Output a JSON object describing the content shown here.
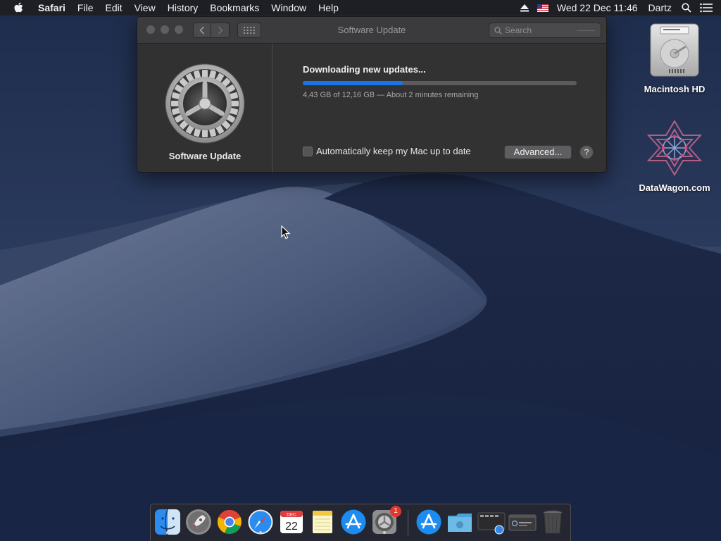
{
  "menubar": {
    "app_name": "Safari",
    "items": [
      "File",
      "Edit",
      "View",
      "History",
      "Bookmarks",
      "Window",
      "Help"
    ],
    "clock": "Wed 22 Dec  11:46",
    "user": "Dartz",
    "status_icons": [
      "eject-icon",
      "us-flag-icon",
      "spotlight-search-icon",
      "notification-center-icon"
    ]
  },
  "window": {
    "title": "Software Update",
    "search_placeholder": "Search",
    "pane_label": "Software Update",
    "status_title": "Downloading new updates...",
    "progress_fraction": 0.3643,
    "progress_detail": "4,43 GB of 12,16 GB — About 2 minutes remaining",
    "auto_update_label": "Automatically keep my Mac up to date",
    "auto_update_checked": false,
    "advanced_label": "Advanced...",
    "help_label": "?"
  },
  "desktop_icons": [
    {
      "label": "Macintosh HD",
      "icon": "hard-drive-icon"
    },
    {
      "label": "DataWagon.com",
      "icon": "star-pattern-icon"
    }
  ],
  "dock": {
    "calendar_month": "DEC",
    "calendar_day": "22",
    "system_preferences_badge": "1",
    "apps": [
      "finder",
      "launchpad",
      "chrome",
      "safari",
      "calendar",
      "notes",
      "app-store",
      "system-preferences",
      "app-store-downloads",
      "documents-folder",
      "screenshot-stack",
      "terminal-window",
      "trash"
    ]
  },
  "colors": {
    "accent": "#1a73e8",
    "window_bg": "#323232",
    "menubar_bg": "#1e1e22",
    "badge_red": "#e5362e"
  }
}
